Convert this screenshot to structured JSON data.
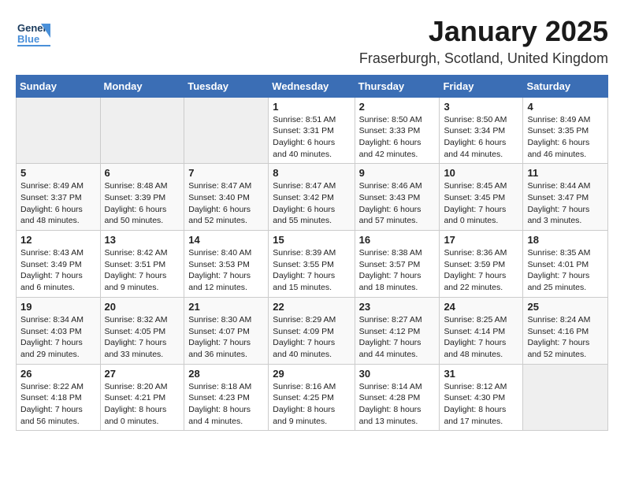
{
  "header": {
    "logo_general": "General",
    "logo_blue": "Blue",
    "month": "January 2025",
    "location": "Fraserburgh, Scotland, United Kingdom"
  },
  "weekdays": [
    "Sunday",
    "Monday",
    "Tuesday",
    "Wednesday",
    "Thursday",
    "Friday",
    "Saturday"
  ],
  "weeks": [
    [
      {
        "day": "",
        "empty": true
      },
      {
        "day": "",
        "empty": true
      },
      {
        "day": "",
        "empty": true
      },
      {
        "day": "1",
        "sunrise": "Sunrise: 8:51 AM",
        "sunset": "Sunset: 3:31 PM",
        "daylight": "Daylight: 6 hours and 40 minutes."
      },
      {
        "day": "2",
        "sunrise": "Sunrise: 8:50 AM",
        "sunset": "Sunset: 3:33 PM",
        "daylight": "Daylight: 6 hours and 42 minutes."
      },
      {
        "day": "3",
        "sunrise": "Sunrise: 8:50 AM",
        "sunset": "Sunset: 3:34 PM",
        "daylight": "Daylight: 6 hours and 44 minutes."
      },
      {
        "day": "4",
        "sunrise": "Sunrise: 8:49 AM",
        "sunset": "Sunset: 3:35 PM",
        "daylight": "Daylight: 6 hours and 46 minutes."
      }
    ],
    [
      {
        "day": "5",
        "sunrise": "Sunrise: 8:49 AM",
        "sunset": "Sunset: 3:37 PM",
        "daylight": "Daylight: 6 hours and 48 minutes."
      },
      {
        "day": "6",
        "sunrise": "Sunrise: 8:48 AM",
        "sunset": "Sunset: 3:39 PM",
        "daylight": "Daylight: 6 hours and 50 minutes."
      },
      {
        "day": "7",
        "sunrise": "Sunrise: 8:47 AM",
        "sunset": "Sunset: 3:40 PM",
        "daylight": "Daylight: 6 hours and 52 minutes."
      },
      {
        "day": "8",
        "sunrise": "Sunrise: 8:47 AM",
        "sunset": "Sunset: 3:42 PM",
        "daylight": "Daylight: 6 hours and 55 minutes."
      },
      {
        "day": "9",
        "sunrise": "Sunrise: 8:46 AM",
        "sunset": "Sunset: 3:43 PM",
        "daylight": "Daylight: 6 hours and 57 minutes."
      },
      {
        "day": "10",
        "sunrise": "Sunrise: 8:45 AM",
        "sunset": "Sunset: 3:45 PM",
        "daylight": "Daylight: 7 hours and 0 minutes."
      },
      {
        "day": "11",
        "sunrise": "Sunrise: 8:44 AM",
        "sunset": "Sunset: 3:47 PM",
        "daylight": "Daylight: 7 hours and 3 minutes."
      }
    ],
    [
      {
        "day": "12",
        "sunrise": "Sunrise: 8:43 AM",
        "sunset": "Sunset: 3:49 PM",
        "daylight": "Daylight: 7 hours and 6 minutes."
      },
      {
        "day": "13",
        "sunrise": "Sunrise: 8:42 AM",
        "sunset": "Sunset: 3:51 PM",
        "daylight": "Daylight: 7 hours and 9 minutes."
      },
      {
        "day": "14",
        "sunrise": "Sunrise: 8:40 AM",
        "sunset": "Sunset: 3:53 PM",
        "daylight": "Daylight: 7 hours and 12 minutes."
      },
      {
        "day": "15",
        "sunrise": "Sunrise: 8:39 AM",
        "sunset": "Sunset: 3:55 PM",
        "daylight": "Daylight: 7 hours and 15 minutes."
      },
      {
        "day": "16",
        "sunrise": "Sunrise: 8:38 AM",
        "sunset": "Sunset: 3:57 PM",
        "daylight": "Daylight: 7 hours and 18 minutes."
      },
      {
        "day": "17",
        "sunrise": "Sunrise: 8:36 AM",
        "sunset": "Sunset: 3:59 PM",
        "daylight": "Daylight: 7 hours and 22 minutes."
      },
      {
        "day": "18",
        "sunrise": "Sunrise: 8:35 AM",
        "sunset": "Sunset: 4:01 PM",
        "daylight": "Daylight: 7 hours and 25 minutes."
      }
    ],
    [
      {
        "day": "19",
        "sunrise": "Sunrise: 8:34 AM",
        "sunset": "Sunset: 4:03 PM",
        "daylight": "Daylight: 7 hours and 29 minutes."
      },
      {
        "day": "20",
        "sunrise": "Sunrise: 8:32 AM",
        "sunset": "Sunset: 4:05 PM",
        "daylight": "Daylight: 7 hours and 33 minutes."
      },
      {
        "day": "21",
        "sunrise": "Sunrise: 8:30 AM",
        "sunset": "Sunset: 4:07 PM",
        "daylight": "Daylight: 7 hours and 36 minutes."
      },
      {
        "day": "22",
        "sunrise": "Sunrise: 8:29 AM",
        "sunset": "Sunset: 4:09 PM",
        "daylight": "Daylight: 7 hours and 40 minutes."
      },
      {
        "day": "23",
        "sunrise": "Sunrise: 8:27 AM",
        "sunset": "Sunset: 4:12 PM",
        "daylight": "Daylight: 7 hours and 44 minutes."
      },
      {
        "day": "24",
        "sunrise": "Sunrise: 8:25 AM",
        "sunset": "Sunset: 4:14 PM",
        "daylight": "Daylight: 7 hours and 48 minutes."
      },
      {
        "day": "25",
        "sunrise": "Sunrise: 8:24 AM",
        "sunset": "Sunset: 4:16 PM",
        "daylight": "Daylight: 7 hours and 52 minutes."
      }
    ],
    [
      {
        "day": "26",
        "sunrise": "Sunrise: 8:22 AM",
        "sunset": "Sunset: 4:18 PM",
        "daylight": "Daylight: 7 hours and 56 minutes."
      },
      {
        "day": "27",
        "sunrise": "Sunrise: 8:20 AM",
        "sunset": "Sunset: 4:21 PM",
        "daylight": "Daylight: 8 hours and 0 minutes."
      },
      {
        "day": "28",
        "sunrise": "Sunrise: 8:18 AM",
        "sunset": "Sunset: 4:23 PM",
        "daylight": "Daylight: 8 hours and 4 minutes."
      },
      {
        "day": "29",
        "sunrise": "Sunrise: 8:16 AM",
        "sunset": "Sunset: 4:25 PM",
        "daylight": "Daylight: 8 hours and 9 minutes."
      },
      {
        "day": "30",
        "sunrise": "Sunrise: 8:14 AM",
        "sunset": "Sunset: 4:28 PM",
        "daylight": "Daylight: 8 hours and 13 minutes."
      },
      {
        "day": "31",
        "sunrise": "Sunrise: 8:12 AM",
        "sunset": "Sunset: 4:30 PM",
        "daylight": "Daylight: 8 hours and 17 minutes."
      },
      {
        "day": "",
        "empty": true
      }
    ]
  ]
}
